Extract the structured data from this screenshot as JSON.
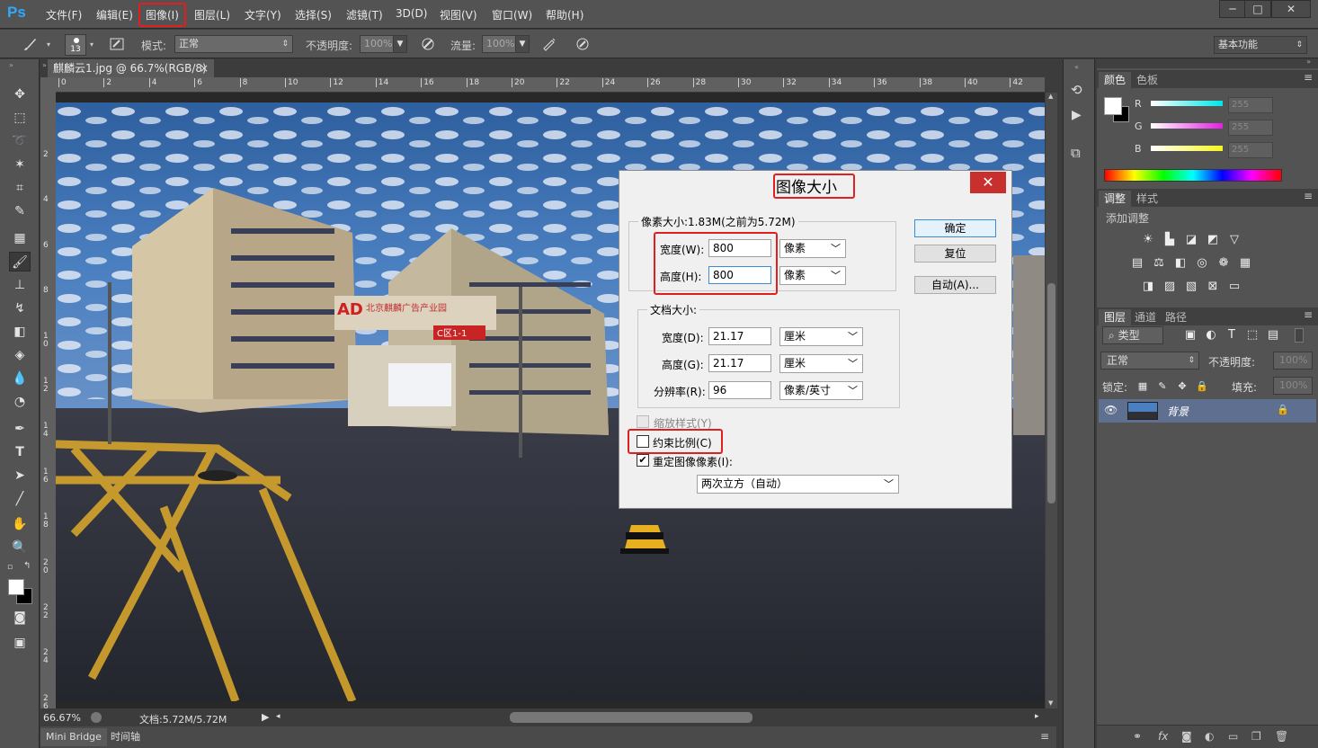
{
  "app": {
    "logo": "Ps"
  },
  "menu": [
    "文件(F)",
    "编辑(E)",
    "图像(I)",
    "图层(L)",
    "文字(Y)",
    "选择(S)",
    "滤镜(T)",
    "3D(D)",
    "视图(V)",
    "窗口(W)",
    "帮助(H)"
  ],
  "window_controls": [
    "─",
    "□",
    "✕"
  ],
  "options": {
    "brush_size": "13",
    "mode_label": "模式:",
    "mode_value": "正常",
    "opacity_label": "不透明度:",
    "opacity_value": "100%",
    "flow_label": "流量:",
    "flow_value": "100%",
    "workspace": "基本功能"
  },
  "document": {
    "tab_title": "麒麟云1.jpg @ 66.7%(RGB/8)",
    "tab_close": "×",
    "zoom": "66.67%",
    "doc_info": "文档:5.72M/5.72M"
  },
  "ruler": {
    "top": [
      "0",
      "2",
      "4",
      "6",
      "8",
      "10",
      "12",
      "14",
      "16",
      "18",
      "20",
      "22",
      "24",
      "26",
      "28",
      "30",
      "32",
      "34",
      "36",
      "38",
      "40",
      "42"
    ],
    "left": [
      "2",
      "4",
      "6",
      "8",
      "10",
      "12",
      "14",
      "16",
      "18",
      "20",
      "22",
      "24",
      "26"
    ]
  },
  "bottom_tabs": [
    "Mini Bridge",
    "时间轴"
  ],
  "color_panel": {
    "tabs": [
      "颜色",
      "色板"
    ],
    "channels": [
      {
        "label": "R",
        "value": "255"
      },
      {
        "label": "G",
        "value": "255"
      },
      {
        "label": "B",
        "value": "255"
      }
    ],
    "colors": {
      "r": "#00e5e5",
      "g": "#e51ee5",
      "b": "#f5f51e"
    }
  },
  "adjust_panel": {
    "tabs": [
      "调整",
      "样式"
    ],
    "add_label": "添加调整"
  },
  "layers_panel": {
    "tabs": [
      "图层",
      "通道",
      "路径"
    ],
    "filter_type": "类型",
    "blend_mode": "正常",
    "opacity_label": "不透明度:",
    "opacity_value": "100%",
    "lock_label": "锁定:",
    "fill_label": "填充:",
    "fill_value": "100%",
    "layers": [
      {
        "name": "背景"
      }
    ]
  },
  "dialog": {
    "title": "图像大小",
    "close": "✕",
    "pixel_group_title": "像素大小:1.83M(之前为5.72M)",
    "width_label": "宽度(W):",
    "width_value": "800",
    "width_unit": "像素",
    "height_label": "高度(H):",
    "height_value": "800",
    "height_unit": "像素",
    "doc_group_title": "文档大小:",
    "doc_width_label": "宽度(D):",
    "doc_width_value": "21.17",
    "doc_width_unit": "厘米",
    "doc_height_label": "高度(G):",
    "doc_height_value": "21.17",
    "doc_height_unit": "厘米",
    "resolution_label": "分辨率(R):",
    "resolution_value": "96",
    "resolution_unit": "像素/英寸",
    "scale_styles": "缩放样式(Y)",
    "constrain": "约束比例(C)",
    "resample": "重定图像像素(I):",
    "resample_method": "两次立方（自动）",
    "ok": "确定",
    "reset": "复位",
    "auto": "自动(A)...",
    "checkmark": "✔"
  },
  "scene_text": {
    "sign_ad": "AD",
    "sign_cn": "北京麒麟广告产业园",
    "sign_c": "C区1-1"
  }
}
